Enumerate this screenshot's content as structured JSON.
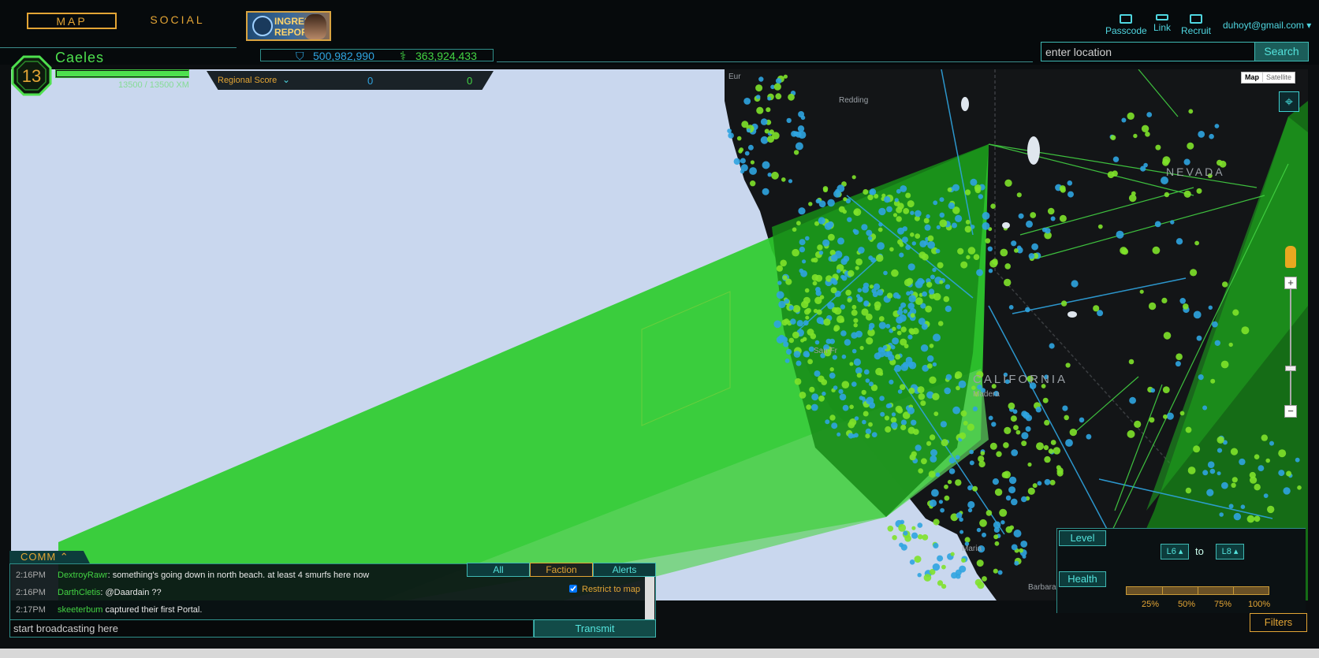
{
  "nav": {
    "map_label": "MAP",
    "social_label": "SOCIAL",
    "ingress_report_label": "INGRESS REPORT"
  },
  "scores": {
    "resistance": "500,982,990",
    "enlightened": "363,924,433"
  },
  "header_links": {
    "passcode": "Passcode",
    "link": "Link",
    "recruit": "Recruit",
    "user_email": "duhoyt@gmail.com"
  },
  "search": {
    "placeholder": "enter location",
    "button_label": "Search"
  },
  "agent": {
    "level": "13",
    "name": "Caeles",
    "xm_text": "13500 / 13500 XM",
    "xm_fraction": 1.0
  },
  "regional_score": {
    "label": "Regional Score",
    "resistance": "0",
    "enlightened": "0"
  },
  "map": {
    "type_map": "Map",
    "type_satellite": "Satellite",
    "labels": {
      "nevada": "NEVADA",
      "california": "CALIFORNIA",
      "madera": "Madera",
      "maria": "Maria",
      "barbara": "Barbara",
      "san_francisco": "San Fr",
      "eureka": "Eur",
      "redding": "Redding"
    },
    "colors": {
      "water": "#c9d7ee",
      "land": "#131517",
      "enlightened_field": "#22c322",
      "resistance_portal": "#2fa4e0",
      "enlightened_portal": "#7fe22a"
    }
  },
  "filters": {
    "level_label": "Level",
    "level_from": "L6",
    "level_to_word": "to",
    "level_to": "L8",
    "health_label": "Health",
    "health_ticks": [
      "25%",
      "50%",
      "75%",
      "100%"
    ],
    "button_label": "Filters"
  },
  "comm": {
    "title": "COMM",
    "tabs": [
      "All",
      "Faction",
      "Alerts"
    ],
    "active_tab": "Faction",
    "restrict_label": "Restrict to map",
    "messages": [
      {
        "time": "2:16PM",
        "agent": "DextroyRawr",
        "text": ": something's going down in north beach. at least 4 smurfs here now"
      },
      {
        "time": "2:16PM",
        "agent": "DarthCletis",
        "text": ": @Daardain ??"
      },
      {
        "time": "2:17PM",
        "agent": "skeeterbum",
        "text": " captured their first Portal."
      }
    ],
    "broadcast_placeholder": "start broadcasting here",
    "transmit_label": "Transmit"
  }
}
